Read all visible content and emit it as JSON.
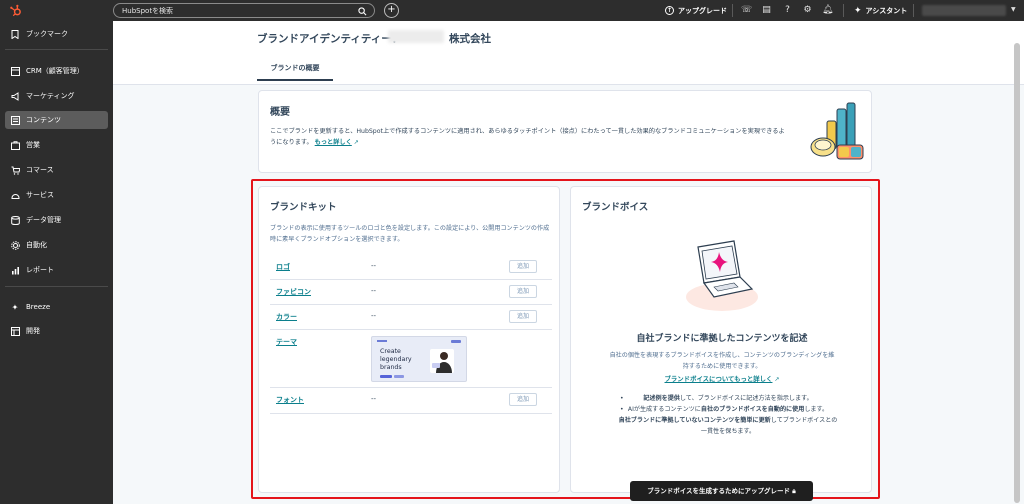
{
  "topbar": {
    "search_placeholder": "HubSpotを検索",
    "plus": "+",
    "upgrade_label": "アップグレード",
    "assistant_label": "アシスタント"
  },
  "sidebar": {
    "items": [
      {
        "label": "ブックマーク",
        "icon": "bookmark-icon"
      },
      {
        "label": "CRM（顧客管理）",
        "icon": "crm-icon"
      },
      {
        "label": "マーケティング",
        "icon": "megaphone-icon"
      },
      {
        "label": "コンテンツ",
        "icon": "content-icon"
      },
      {
        "label": "営業",
        "icon": "sales-icon"
      },
      {
        "label": "コマース",
        "icon": "commerce-icon"
      },
      {
        "label": "サービス",
        "icon": "service-icon"
      },
      {
        "label": "データ管理",
        "icon": "database-icon"
      },
      {
        "label": "自動化",
        "icon": "automation-icon"
      },
      {
        "label": "レポート",
        "icon": "report-icon"
      },
      {
        "label": "Breeze",
        "icon": "breeze-icon"
      },
      {
        "label": "開発",
        "icon": "dev-icon"
      }
    ],
    "active": "コンテンツ"
  },
  "header": {
    "title_prefix": "ブランドアイデンティティー：",
    "title_suffix": "株式会社",
    "tab": "ブランドの概要"
  },
  "overview": {
    "title": "概要",
    "text": "ここでブランドを更新すると、HubSpot上で作成するコンテンツに適用され、あらゆるタッチポイント（接点）にわたって一貫した効果的なブランドコミュニケーションを実現できるようになります。",
    "link": "もっと詳しく"
  },
  "brand_kit": {
    "title": "ブランドキット",
    "desc": "ブランドの表示に使用するツールのロゴと色を設定します。この設定により、公開用コンテンツの作成時に素早くブランドオプションを選択できます。",
    "rows": [
      {
        "label": "ロゴ",
        "value": "--",
        "button": "追加"
      },
      {
        "label": "ファビコン",
        "value": "--",
        "button": "追加"
      },
      {
        "label": "カラー",
        "value": "--",
        "button": "追加"
      },
      {
        "label": "テーマ",
        "value": "",
        "button": ""
      },
      {
        "label": "フォント",
        "value": "--",
        "button": "追加"
      }
    ],
    "theme_preview_text": [
      "Create",
      "legendary",
      "brands"
    ]
  },
  "brand_voice": {
    "title": "ブランドボイス",
    "heading": "自社ブランドに準拠したコンテンツを記述",
    "desc": "自社の個性を表現するブランドボイスを作成し、コンテンツのブランディングを維持するために使用できます。",
    "link": "ブランドボイスについてもっと詳しく",
    "bullets": [
      {
        "bold": "記述例を提供",
        "rest": "して、ブランドボイスに記述方法を指示します。"
      },
      {
        "pre": "AIが生成するコンテンツに",
        "bold": "自社のブランドボイスを自動的に使用",
        "rest": "します。"
      },
      {
        "bold": "自社ブランドに準拠していないコンテンツを簡単に更新",
        "rest": "してブランドボイスとの一貫性を保ちます。"
      }
    ],
    "button": "ブランドボイスを生成するためにアップグレード"
  },
  "colors": {
    "topbar": "#2d2d2d",
    "accent_link": "#0b7f8c",
    "highlight": "#e4141b",
    "hubspot_orange": "#ff5c35"
  }
}
